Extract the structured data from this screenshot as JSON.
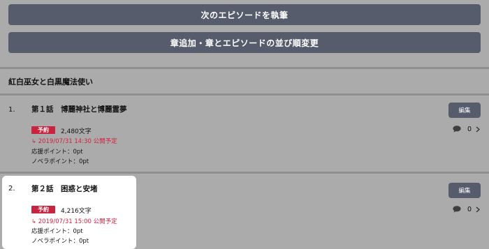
{
  "buttons": {
    "write_next": "次のエピソードを執筆",
    "reorder": "章追加・章とエピソードの並び順変更"
  },
  "story": {
    "title": "紅白巫女と白黒魔法使い"
  },
  "episodes": [
    {
      "number": "1.",
      "title": "第１話　博麗神社と博麗霊夢",
      "badge": "予約",
      "char_count": "2,480文字",
      "schedule_arrow": "↳",
      "schedule": "2019/07/31 14:30 公開予定",
      "support_points": "応援ポイント：0pt",
      "novel_points": "ノベラポイント：0pt",
      "edit_label": "編集",
      "comment_count": "0"
    },
    {
      "number": "2.",
      "title": "第２話　困惑と安堵",
      "badge": "予約",
      "char_count": "4,216文字",
      "schedule_arrow": "↳",
      "schedule": "2019/07/31 15:00 公開予定",
      "support_points": "応援ポイント：0pt",
      "novel_points": "ノベラポイント：0pt",
      "edit_label": "編集",
      "comment_count": "0"
    }
  ],
  "colors": {
    "button_bg": "#575c6d",
    "badge_red": "#c8243f",
    "schedule_red": "#d0213f",
    "page_bg": "#ababab"
  },
  "icons": {
    "comment": "speech-bubble-icon",
    "chevron": "chevron-right-icon"
  }
}
